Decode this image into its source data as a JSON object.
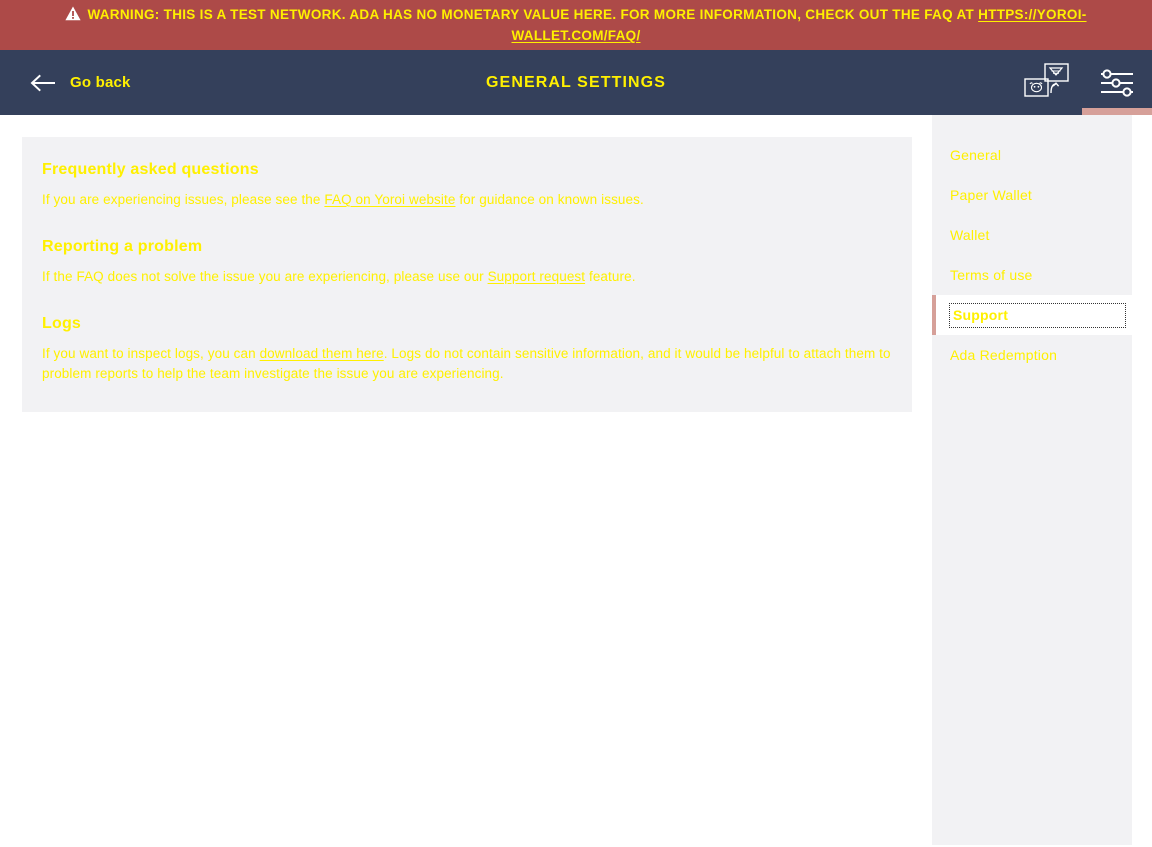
{
  "banner": {
    "icon": "warning-triangle-icon",
    "text_before": "WARNING: THIS IS A TEST NETWORK. ADA HAS NO MONETARY VALUE HERE. FOR MORE INFORMATION, CHECK OUT THE FAQ AT ",
    "link_text": "HTTPS://YOROI-WALLET.COM/FAQ/",
    "background_color": "#ad4a48",
    "text_color": "#fff000"
  },
  "topbar": {
    "back_label": "Go back",
    "back_icon": "arrow-left-icon",
    "title": "GENERAL SETTINGS",
    "background_color": "#34405b",
    "text_color": "#fff000",
    "actions": [
      {
        "name": "wallet-switch-icon",
        "label": "Switch wallet",
        "active": false
      },
      {
        "name": "settings-sliders-icon",
        "label": "Settings",
        "active": true
      }
    ],
    "active_indicator_color": "#d6a099"
  },
  "content": {
    "background_color": "#f2f2f4",
    "sections": [
      {
        "heading": "Frequently asked questions",
        "body_before": "If you are experiencing issues, please see the ",
        "link": "FAQ on Yoroi website",
        "body_after": " for guidance on known issues."
      },
      {
        "heading": "Reporting a problem",
        "body_before": "If the FAQ does not solve the issue you are experiencing, please use our ",
        "link": "Support request",
        "body_after": " feature."
      },
      {
        "heading": "Logs",
        "body_before": "If you want to inspect logs, you can ",
        "link": "download them here",
        "body_after": ". Logs do not contain sensitive information, and it would be helpful to attach them to problem reports to help the team investigate the issue you are experiencing."
      }
    ]
  },
  "settings_menu": {
    "background_color": "#f2f2f4",
    "active_marker_color": "#d6a099",
    "items": [
      {
        "label": "General",
        "active": false
      },
      {
        "label": "Paper Wallet",
        "active": false
      },
      {
        "label": "Wallet",
        "active": false
      },
      {
        "label": "Terms of use",
        "active": false
      },
      {
        "label": "Support",
        "active": true
      },
      {
        "label": "Ada Redemption",
        "active": false
      }
    ]
  }
}
